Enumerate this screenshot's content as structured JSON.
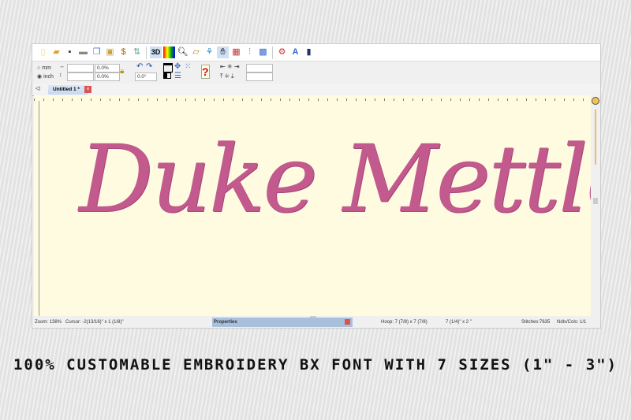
{
  "toolbar": {
    "icons": [
      "new-file",
      "open-folder",
      "save",
      "print",
      "copy",
      "paste",
      "stitch-dollar",
      "stitch-sort",
      "3d-view",
      "color-chart",
      "zoom",
      "measure",
      "hoop",
      "hand-pan",
      "color-palette",
      "thread-needle",
      "pattern-grid",
      "gear-settings",
      "text-a",
      "machine"
    ],
    "label_3d": "3D"
  },
  "options": {
    "unit_mm": "mm",
    "unit_inch": "inch",
    "selected_unit": "inch",
    "width_pct": "0.0%",
    "height_pct": "0.0%",
    "rotation": "0.0°"
  },
  "tab": {
    "label": "Untitled 1 *"
  },
  "design": {
    "text": "Duke Mettle",
    "color": "#c25a8e"
  },
  "status": {
    "zoom": "Zoom: 138%",
    "cursor": "Cursor: -2(13/16)\" x 1 (1/8)\"",
    "properties": "Properties",
    "hoop": "Hoop: 7 (7/8) x 7 (7/8)",
    "size": "7 (1/4)\" x 2 \"",
    "stitches": "Stitches:7635",
    "ndls": "Ndls/Cols: 1/1"
  },
  "caption": "100% CUSTOMABLE EMBROIDERY BX FONT WITH 7 SIZES (1\" -  3\")"
}
